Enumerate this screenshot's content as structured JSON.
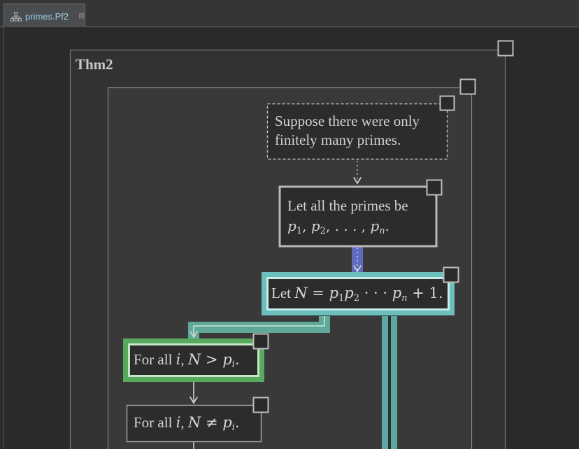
{
  "tab": {
    "label": "primes.Pf2",
    "close": "⊠",
    "icon": "tree-structure-icon"
  },
  "diagram": {
    "outer_title": "Thm2",
    "nodes": {
      "suppose": {
        "line1": "Suppose there were only",
        "line2": "finitely many primes."
      },
      "letprimes": {
        "line1": "Let all the primes be",
        "seq": [
          "p",
          "1",
          ", ",
          "p",
          "2",
          ", . . . , ",
          "p",
          "n",
          "."
        ]
      },
      "letN": {
        "prefix": "Let ",
        "var": "N",
        "eq": " = ",
        "expr": [
          "p",
          "1",
          "p",
          "2",
          " · · · ",
          "p",
          "n"
        ],
        "suffix": " + 1."
      },
      "forall_gt": {
        "prefix": "For all ",
        "i": "i",
        "comma": ", ",
        "N": "N",
        "rel": " > ",
        "p": "p",
        "sub": "i",
        "end": "."
      },
      "forall_ne": {
        "prefix": "For all ",
        "i": "i",
        "comma": ", ",
        "N": "N",
        "rel": " ≠ ",
        "p": "p",
        "sub": "i",
        "end": "."
      }
    },
    "colors": {
      "background": "#2a2a2a",
      "box_fill": "#333333",
      "teal": "#7ad0cc",
      "green": "#6fbe73",
      "flow_blue": "#5e6bbf",
      "border_gray": "#8d8d8d"
    }
  }
}
